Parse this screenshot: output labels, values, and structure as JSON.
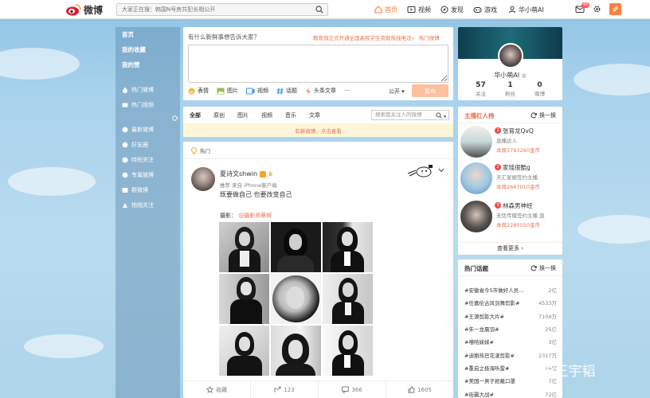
{
  "header": {
    "logo_text": "微博",
    "search_placeholder": "大家正在搜：韩国N号房共犯长相公开",
    "nav": [
      {
        "label": "首页",
        "icon": "home-icon",
        "active": true
      },
      {
        "label": "视频",
        "icon": "video-icon",
        "active": false
      },
      {
        "label": "发现",
        "icon": "discover-icon",
        "active": false
      },
      {
        "label": "游戏",
        "icon": "game-icon",
        "active": false
      }
    ],
    "username": "华小萌AI",
    "message_badge": "45"
  },
  "leftnav": {
    "main": [
      "首页",
      "我的收藏",
      "我的赞"
    ],
    "items": [
      "热门微博",
      "热门视频",
      "最新微博",
      "好友圈",
      "特别关注",
      "专属微博",
      "群微博",
      "悄悄关注"
    ]
  },
  "composer": {
    "title": "有什么新鲜事想告诉大家？",
    "hot_topic": "教育部正式开通全国高校学生资助热线电话»",
    "hot_label": "热门微博",
    "tools": [
      {
        "label": "表情",
        "icon": "emoji-icon"
      },
      {
        "label": "图片",
        "icon": "image-icon"
      },
      {
        "label": "视频",
        "icon": "video-icon"
      },
      {
        "label": "话题",
        "icon": "topic-icon"
      },
      {
        "label": "头条文章",
        "icon": "article-icon"
      },
      {
        "label": "···",
        "icon": "more-icon"
      }
    ],
    "visibility": "公开",
    "publish_label": "发布"
  },
  "tabs": {
    "items": [
      "全部",
      "原创",
      "图片",
      "视频",
      "音乐",
      "文章"
    ],
    "search_placeholder": "搜索我关注人的微博",
    "new_notice": "有新微博，点击查看"
  },
  "post": {
    "section_label": "热门",
    "author": "夏诗文shwin",
    "meta": "推荐 来自 iPhone客户端",
    "text": "既要做自己 也要改变自己",
    "photo_label": "摄影：",
    "photo_credit": "@摄影师蔡辉",
    "actions": [
      {
        "label": "收藏",
        "icon": "star-icon"
      },
      {
        "label": "123",
        "icon": "share-icon"
      },
      {
        "label": "366",
        "icon": "comment-icon"
      },
      {
        "label": "1605",
        "icon": "like-icon"
      }
    ]
  },
  "profile": {
    "name": "华小萌AI",
    "stats": [
      {
        "value": "57",
        "label": "关注"
      },
      {
        "value": "1",
        "label": "粉丝"
      },
      {
        "value": "0",
        "label": "微博"
      }
    ]
  },
  "hot_people": {
    "title": "主播红人榜",
    "switch_label": "换一换",
    "more_label": "查看更多 ›",
    "items": [
      {
        "rank": "1",
        "name": "张育龙QvQ",
        "desc": "直播达人",
        "week": "本周3793260金币"
      },
      {
        "rank": "2",
        "name": "家瑶很酷g",
        "desc": "天汇星娱签约主播",
        "week": "本周2667010金币"
      },
      {
        "rank": "3",
        "name": "林森男神经",
        "desc": "无忧传媒签约主播 直",
        "week": "本周2280550金币"
      }
    ]
  },
  "hot_topics": {
    "title": "热门话题",
    "switch_label": "换一换",
    "items": [
      {
        "name": "#安徽省今5市做好人员...",
        "count": "2亿"
      },
      {
        "name": "#任嘉伦古风剑舞剪影#",
        "count": "4533万"
      },
      {
        "name": "#王源剪影大片#",
        "count": "7104万"
      },
      {
        "name": "#朱一龙晨羽#",
        "count": "25亿"
      },
      {
        "name": "#嘻哈妹妹#",
        "count": "3亿"
      },
      {
        "name": "#迪丽热巴花漾剪影#",
        "count": "2317万"
      },
      {
        "name": "#重启之极海听雷#",
        "count": "14亿"
      },
      {
        "name": "#美国一男子拒戴口罩",
        "count": "7亿"
      },
      {
        "name": "#街霸大战#",
        "count": "72亿"
      }
    ]
  },
  "watermark": "知乎 @王宇韬"
}
